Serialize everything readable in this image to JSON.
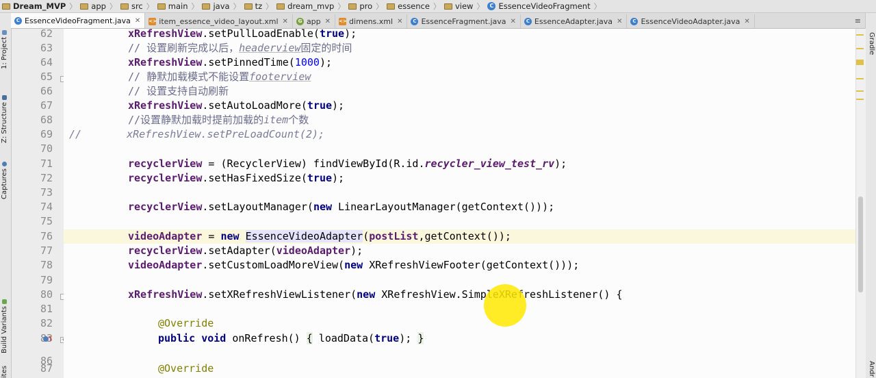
{
  "breadcrumbs": [
    "Dream_MVP",
    "app",
    "src",
    "main",
    "java",
    "tz",
    "dream_mvp",
    "pro",
    "essence",
    "view",
    "EssenceVideoFragment"
  ],
  "tabs": [
    {
      "label": "EssenceVideoFragment.java",
      "icon": "class-icon",
      "active": true
    },
    {
      "label": "item_essence_video_layout.xml",
      "icon": "xml-icon",
      "active": false
    },
    {
      "label": "app",
      "icon": "gradle-module-icon",
      "active": false
    },
    {
      "label": "dimens.xml",
      "icon": "xml-icon",
      "active": false
    },
    {
      "label": "EssenceFragment.java",
      "icon": "class-icon",
      "active": false
    },
    {
      "label": "EssenceAdapter.java",
      "icon": "class-icon",
      "active": false
    },
    {
      "label": "EssenceVideoAdapter.java",
      "icon": "class-icon",
      "active": false
    }
  ],
  "tab_overflow": "≡",
  "left_tools": [
    "1: Project",
    "Z: Structure",
    "Captures",
    "Build Variants",
    "ites"
  ],
  "right_tools": [
    "Gradle",
    "Andr"
  ],
  "line_numbers": [
    "62",
    "63",
    "64",
    "65",
    "66",
    "67",
    "68",
    "69",
    "70",
    "71",
    "72",
    "73",
    "74",
    "75",
    "76",
    "77",
    "78",
    "79",
    "80",
    "81",
    "82",
    "83",
    "86",
    "87"
  ],
  "code": {
    "l62": {
      "a": "xRefreshView",
      "b": ".setPullLoadEnable(",
      "c": "true",
      "d": ");"
    },
    "l63": {
      "a": "// 设置刷新完成以后，",
      "b": "headerview",
      "c": "固定的时间"
    },
    "l64": {
      "a": "xRefreshView",
      "b": ".setPinnedTime(",
      "c": "1000",
      "d": ");"
    },
    "l65": {
      "a": "// 静默加载模式不能设置",
      "b": "footerview"
    },
    "l66": {
      "a": "// 设置支持自动刷新"
    },
    "l67": {
      "a": "xRefreshView",
      "b": ".setAutoLoadMore(",
      "c": "true",
      "d": ");"
    },
    "l68": {
      "a": "//设置静默加载时提前加载的",
      "b": "item",
      "c": "个数"
    },
    "l69": {
      "pre": "//",
      "a": "xRefreshView.setPreLoadCount(2);"
    },
    "l71": {
      "a": "recyclerView",
      "b": " = (RecyclerView) findViewById(R.id.",
      "c": "recycler_view_test_rv",
      "d": ");"
    },
    "l72": {
      "a": "recyclerView",
      "b": ".setHasFixedSize(",
      "c": "true",
      "d": ");"
    },
    "l74": {
      "a": "recyclerView",
      "b": ".setLayoutManager(",
      "c": "new",
      "d": " LinearLayoutManager(getContext()));"
    },
    "l76": {
      "a": "videoAdapter",
      "b": " = ",
      "c": "new",
      "d": " ",
      "e": "EssenceVideoAdapter",
      "f": "(",
      "g": "postList",
      "h": ",getContext());"
    },
    "l77": {
      "a": "recyclerView",
      "b": ".setAdapter(",
      "c": "videoAdapter",
      "d": ");"
    },
    "l78": {
      "a": "videoAdapter",
      "b": ".setCustomLoadMoreView(",
      "c": "new",
      "d": " XRefreshViewFooter(getContext()));"
    },
    "l80": {
      "a": "xRefreshView",
      "b": ".setXRefreshViewListener(",
      "c": "new",
      "d": " XRefreshView.SimpleXRefreshListener() {"
    },
    "l82": {
      "a": "@Override"
    },
    "l83": {
      "a": "public",
      "b": " ",
      "c": "void",
      "d": " onRefresh() ",
      "e": "{",
      "f": " loadData(",
      "g": "true",
      "h": "); ",
      "i": "}"
    },
    "l87": {
      "a": "@Override"
    }
  },
  "colors": {
    "keyword": "#000080",
    "field": "#5a1a6e",
    "comment": "#7a7a9a",
    "number": "#0000ff",
    "annotation": "#808000",
    "current_line": "#fbf7dd",
    "cursor_highlight": "#ffe800"
  }
}
